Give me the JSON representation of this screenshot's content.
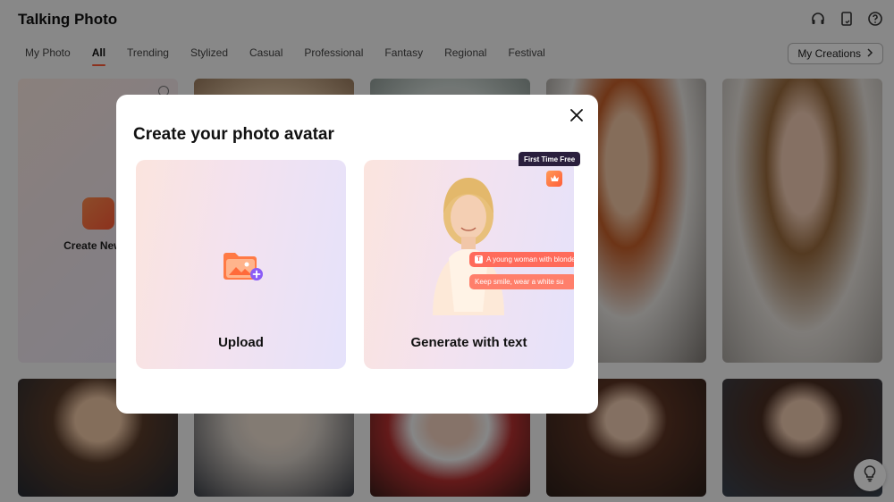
{
  "app": {
    "title": "Talking Photo",
    "tabs": [
      "My Photo",
      "All",
      "Trending",
      "Stylized",
      "Casual",
      "Professional",
      "Fantasy",
      "Regional",
      "Festival"
    ],
    "active_tab": "All",
    "my_creations_label": "My Creations",
    "create_card_label": "Create New P",
    "icons": [
      "headset-icon",
      "tablet-icon",
      "help-circle-icon"
    ]
  },
  "modal": {
    "title": "Create your photo avatar",
    "upload_label": "Upload",
    "generate_label": "Generate with text",
    "badge": "First Time Free",
    "chip_1": "A young woman with blonde",
    "chip_2": "Keep smile, wear a white su"
  },
  "colors": {
    "accent": "#ff5a36",
    "overlay": "rgba(0,0,0,0.45)",
    "badge_bg": "#2a1f3d"
  }
}
